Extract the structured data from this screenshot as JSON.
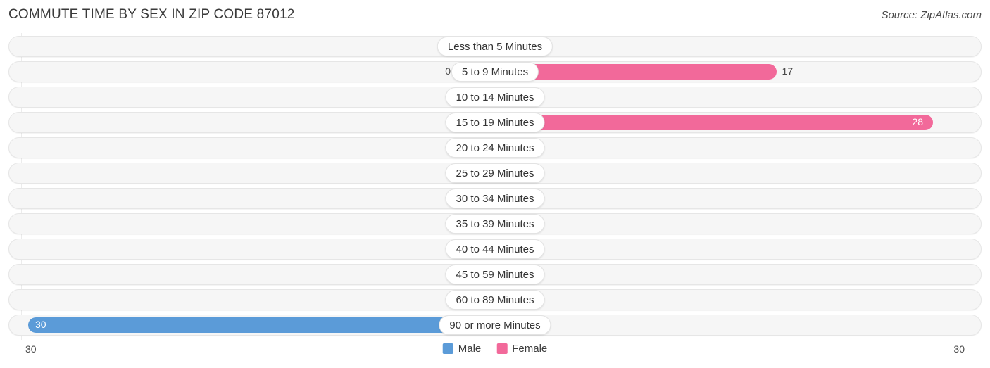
{
  "header": {
    "title": "COMMUTE TIME BY SEX IN ZIP CODE 87012",
    "source": "Source: ZipAtlas.com"
  },
  "legend": {
    "items": [
      {
        "label": "Male",
        "color": "#5b9bd8"
      },
      {
        "label": "Female",
        "color": "#f2699a"
      }
    ]
  },
  "axis": {
    "left_label": "30",
    "right_label": "30"
  },
  "colors": {
    "male_active": "#5b9bd8",
    "male_zero": "#a8c8ea",
    "female_active": "#f2699a",
    "female_zero": "#f7a6c2",
    "track": "#f6f6f6",
    "track_border": "#e6e6e6",
    "gridline": "#ececec",
    "text": "#4a4a4a",
    "text_inverse": "#ffffff"
  },
  "chart_data": {
    "type": "bar",
    "title": "COMMUTE TIME BY SEX IN ZIP CODE 87012",
    "subtitle": "",
    "xlabel": "",
    "ylabel": "",
    "orientation": "horizontal",
    "style": "diverging-bidirectional",
    "grid": false,
    "legend_position": "bottom-center",
    "xlim": [
      30,
      30
    ],
    "axis_max_per_side": 30,
    "categories": [
      "Less than 5 Minutes",
      "5 to 9 Minutes",
      "10 to 14 Minutes",
      "15 to 19 Minutes",
      "20 to 24 Minutes",
      "25 to 29 Minutes",
      "30 to 34 Minutes",
      "35 to 39 Minutes",
      "40 to 44 Minutes",
      "45 to 59 Minutes",
      "60 to 89 Minutes",
      "90 or more Minutes"
    ],
    "series": [
      {
        "name": "Male",
        "direction": "left",
        "color": "#5b9bd8",
        "values": [
          0,
          0,
          0,
          0,
          0,
          0,
          0,
          0,
          0,
          0,
          0,
          30
        ]
      },
      {
        "name": "Female",
        "direction": "right",
        "color": "#f2699a",
        "values": [
          0,
          17,
          0,
          28,
          0,
          0,
          0,
          0,
          0,
          0,
          0,
          0
        ]
      }
    ],
    "rows": [
      {
        "category": "Less than 5 Minutes",
        "male": 0,
        "female": 0,
        "male_label": "0",
        "female_label": "0"
      },
      {
        "category": "5 to 9 Minutes",
        "male": 0,
        "female": 17,
        "male_label": "0",
        "female_label": "17"
      },
      {
        "category": "10 to 14 Minutes",
        "male": 0,
        "female": 0,
        "male_label": "0",
        "female_label": "0"
      },
      {
        "category": "15 to 19 Minutes",
        "male": 0,
        "female": 28,
        "male_label": "0",
        "female_label": "28"
      },
      {
        "category": "20 to 24 Minutes",
        "male": 0,
        "female": 0,
        "male_label": "0",
        "female_label": "0"
      },
      {
        "category": "25 to 29 Minutes",
        "male": 0,
        "female": 0,
        "male_label": "0",
        "female_label": "0"
      },
      {
        "category": "30 to 34 Minutes",
        "male": 0,
        "female": 0,
        "male_label": "0",
        "female_label": "0"
      },
      {
        "category": "35 to 39 Minutes",
        "male": 0,
        "female": 0,
        "male_label": "0",
        "female_label": "0"
      },
      {
        "category": "40 to 44 Minutes",
        "male": 0,
        "female": 0,
        "male_label": "0",
        "female_label": "0"
      },
      {
        "category": "45 to 59 Minutes",
        "male": 0,
        "female": 0,
        "male_label": "0",
        "female_label": "0"
      },
      {
        "category": "60 to 89 Minutes",
        "male": 0,
        "female": 0,
        "male_label": "0",
        "female_label": "0"
      },
      {
        "category": "90 or more Minutes",
        "male": 30,
        "female": 0,
        "male_label": "30",
        "female_label": "0"
      }
    ]
  }
}
